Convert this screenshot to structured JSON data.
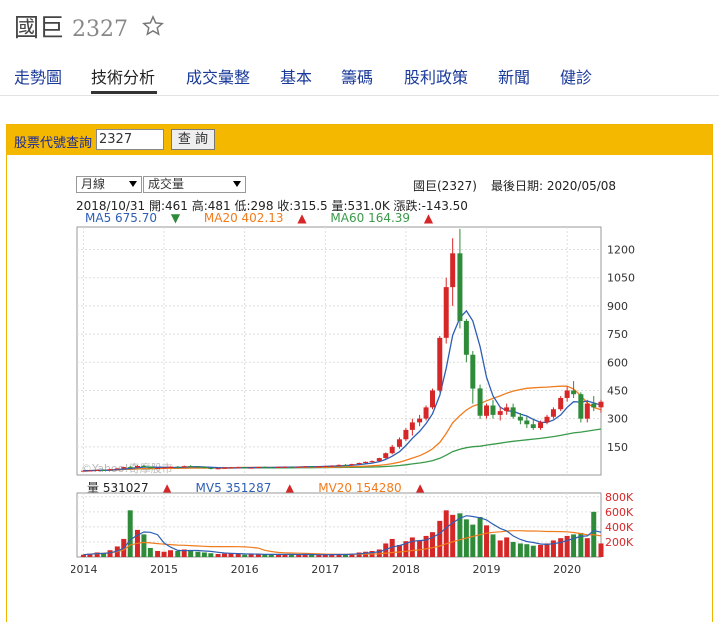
{
  "header": {
    "name": "國巨",
    "code": "2327"
  },
  "tabs": [
    {
      "label": "走勢圖",
      "active": false
    },
    {
      "label": "技術分析",
      "active": true
    },
    {
      "label": "成交彙整",
      "active": false
    },
    {
      "label": "基本",
      "active": false
    },
    {
      "label": "籌碼",
      "active": false
    },
    {
      "label": "股利政策",
      "active": false
    },
    {
      "label": "新聞",
      "active": false
    },
    {
      "label": "健診",
      "active": false
    }
  ],
  "query": {
    "label": "股票代號查詢",
    "value": "2327",
    "button": "查 詢"
  },
  "controls": {
    "period": "月線",
    "indicator": "成交量"
  },
  "chart_header": {
    "stock": "國巨(2327)",
    "last_date": "最後日期: 2020/05/08",
    "ohlc": "2018/10/31 開:461 高:481 低:298 收:315.5 量:531.0K 漲跌:-143.50",
    "ma5": "MA5 675.70",
    "ma20": "MA20 402.13",
    "ma60": "MA60 164.39",
    "ma5_dir": "down",
    "ma20_dir": "up",
    "ma60_dir": "up",
    "vol": "量 531027",
    "mv5": "MV5 351287",
    "mv20": "MV20 154280",
    "watermark": "©Yahoo!奇摩股市"
  },
  "colors": {
    "up": "#d62728",
    "down": "#2e8b3a",
    "ma5": "#2e5fb5",
    "ma20": "#f07c1e",
    "ma60": "#3a9a4a",
    "accent": "#f5b800",
    "link": "#1a3a9a"
  },
  "chart_data": {
    "type": "candlestick",
    "price_axis": {
      "ticks": [
        150,
        300,
        450,
        600,
        750,
        900,
        1050,
        1200
      ],
      "ylim": [
        0,
        1320
      ]
    },
    "volume_axis": {
      "ticks": [
        "200K",
        "400K",
        "600K",
        "800K"
      ],
      "ylim": [
        0,
        850000
      ]
    },
    "x_ticks": [
      "2014",
      "2015",
      "2016",
      "2017",
      "2018",
      "2019",
      "2020"
    ],
    "x_start": 2013.92,
    "x_end": 2020.42,
    "candles": [
      [
        2014.0,
        22,
        24,
        21,
        23
      ],
      [
        2014.08,
        23,
        25,
        22,
        24
      ],
      [
        2014.17,
        24,
        28,
        23,
        27
      ],
      [
        2014.25,
        27,
        30,
        25,
        26
      ],
      [
        2014.33,
        26,
        32,
        25,
        31
      ],
      [
        2014.42,
        31,
        36,
        30,
        35
      ],
      [
        2014.5,
        35,
        44,
        33,
        42
      ],
      [
        2014.58,
        42,
        50,
        38,
        40
      ],
      [
        2014.67,
        40,
        52,
        38,
        48
      ],
      [
        2014.75,
        48,
        55,
        40,
        44
      ],
      [
        2014.83,
        44,
        46,
        34,
        36
      ],
      [
        2014.92,
        36,
        40,
        32,
        38
      ],
      [
        2015.0,
        38,
        42,
        35,
        40
      ],
      [
        2015.08,
        40,
        46,
        38,
        44
      ],
      [
        2015.17,
        44,
        48,
        40,
        42
      ],
      [
        2015.25,
        42,
        50,
        40,
        47
      ],
      [
        2015.33,
        47,
        52,
        42,
        44
      ],
      [
        2015.42,
        44,
        48,
        40,
        43
      ],
      [
        2015.5,
        43,
        45,
        36,
        38
      ],
      [
        2015.58,
        38,
        40,
        30,
        34
      ],
      [
        2015.67,
        34,
        38,
        31,
        36
      ],
      [
        2015.75,
        36,
        40,
        34,
        38
      ],
      [
        2015.83,
        38,
        42,
        36,
        40
      ],
      [
        2015.92,
        40,
        44,
        38,
        41
      ],
      [
        2016.0,
        41,
        43,
        36,
        38
      ],
      [
        2016.08,
        38,
        40,
        35,
        39
      ],
      [
        2016.17,
        39,
        44,
        38,
        42
      ],
      [
        2016.25,
        42,
        45,
        40,
        41
      ],
      [
        2016.33,
        41,
        43,
        38,
        40
      ],
      [
        2016.42,
        40,
        44,
        38,
        43
      ],
      [
        2016.5,
        43,
        46,
        41,
        44
      ],
      [
        2016.58,
        44,
        46,
        40,
        42
      ],
      [
        2016.67,
        42,
        45,
        40,
        44
      ],
      [
        2016.75,
        44,
        48,
        42,
        46
      ],
      [
        2016.83,
        46,
        48,
        42,
        44
      ],
      [
        2016.92,
        44,
        47,
        43,
        46
      ],
      [
        2017.0,
        46,
        50,
        44,
        48
      ],
      [
        2017.08,
        48,
        52,
        46,
        50
      ],
      [
        2017.17,
        50,
        56,
        48,
        54
      ],
      [
        2017.25,
        54,
        58,
        50,
        52
      ],
      [
        2017.33,
        52,
        60,
        50,
        58
      ],
      [
        2017.42,
        58,
        66,
        56,
        64
      ],
      [
        2017.5,
        64,
        72,
        60,
        70
      ],
      [
        2017.58,
        70,
        78,
        66,
        74
      ],
      [
        2017.67,
        74,
        92,
        72,
        90
      ],
      [
        2017.75,
        90,
        120,
        86,
        116
      ],
      [
        2017.83,
        116,
        160,
        110,
        150
      ],
      [
        2017.92,
        150,
        200,
        140,
        190
      ],
      [
        2018.0,
        190,
        250,
        180,
        240
      ],
      [
        2018.08,
        240,
        300,
        210,
        280
      ],
      [
        2018.17,
        280,
        320,
        260,
        300
      ],
      [
        2018.25,
        300,
        370,
        290,
        360
      ],
      [
        2018.33,
        360,
        460,
        350,
        450
      ],
      [
        2018.42,
        450,
        740,
        440,
        730
      ],
      [
        2018.5,
        730,
        1050,
        700,
        1000
      ],
      [
        2018.58,
        1000,
        1260,
        900,
        1180
      ],
      [
        2018.67,
        1180,
        1310,
        780,
        820
      ],
      [
        2018.75,
        820,
        830,
        600,
        640
      ],
      [
        2018.83,
        640,
        660,
        380,
        460
      ],
      [
        2018.92,
        461,
        481,
        298,
        315.5
      ],
      [
        2019.0,
        315,
        380,
        300,
        370
      ],
      [
        2019.08,
        370,
        400,
        300,
        320
      ],
      [
        2019.17,
        320,
        360,
        290,
        340
      ],
      [
        2019.25,
        340,
        380,
        320,
        360
      ],
      [
        2019.33,
        360,
        380,
        300,
        310
      ],
      [
        2019.42,
        310,
        330,
        270,
        290
      ],
      [
        2019.5,
        290,
        310,
        250,
        270
      ],
      [
        2019.58,
        270,
        300,
        240,
        250
      ],
      [
        2019.67,
        250,
        290,
        240,
        280
      ],
      [
        2019.75,
        280,
        320,
        270,
        310
      ],
      [
        2019.83,
        310,
        360,
        300,
        350
      ],
      [
        2019.92,
        350,
        420,
        340,
        410
      ],
      [
        2020.0,
        410,
        470,
        390,
        450
      ],
      [
        2020.08,
        450,
        500,
        410,
        430
      ],
      [
        2020.17,
        430,
        440,
        280,
        300
      ],
      [
        2020.25,
        300,
        400,
        280,
        380
      ],
      [
        2020.33,
        380,
        420,
        340,
        360
      ],
      [
        2020.42,
        360,
        400,
        330,
        390
      ]
    ],
    "volumes": [
      [
        2014.0,
        30000
      ],
      [
        2014.08,
        45000
      ],
      [
        2014.17,
        60000
      ],
      [
        2014.25,
        55000
      ],
      [
        2014.33,
        90000
      ],
      [
        2014.42,
        140000
      ],
      [
        2014.5,
        240000
      ],
      [
        2014.58,
        620000
      ],
      [
        2014.67,
        360000
      ],
      [
        2014.75,
        300000
      ],
      [
        2014.83,
        120000
      ],
      [
        2014.92,
        80000
      ],
      [
        2015.0,
        70000
      ],
      [
        2015.08,
        90000
      ],
      [
        2015.17,
        80000
      ],
      [
        2015.25,
        100000
      ],
      [
        2015.33,
        90000
      ],
      [
        2015.42,
        70000
      ],
      [
        2015.5,
        60000
      ],
      [
        2015.58,
        50000
      ],
      [
        2015.67,
        40000
      ],
      [
        2015.75,
        45000
      ],
      [
        2015.83,
        50000
      ],
      [
        2015.92,
        40000
      ],
      [
        2016.0,
        30000
      ],
      [
        2016.08,
        35000
      ],
      [
        2016.17,
        40000
      ],
      [
        2016.25,
        35000
      ],
      [
        2016.33,
        30000
      ],
      [
        2016.42,
        35000
      ],
      [
        2016.5,
        40000
      ],
      [
        2016.58,
        30000
      ],
      [
        2016.67,
        30000
      ],
      [
        2016.75,
        35000
      ],
      [
        2016.83,
        30000
      ],
      [
        2016.92,
        28000
      ],
      [
        2017.0,
        30000
      ],
      [
        2017.08,
        35000
      ],
      [
        2017.17,
        40000
      ],
      [
        2017.25,
        35000
      ],
      [
        2017.33,
        45000
      ],
      [
        2017.42,
        60000
      ],
      [
        2017.5,
        70000
      ],
      [
        2017.58,
        80000
      ],
      [
        2017.67,
        100000
      ],
      [
        2017.75,
        180000
      ],
      [
        2017.83,
        240000
      ],
      [
        2017.92,
        160000
      ],
      [
        2018.0,
        210000
      ],
      [
        2018.08,
        260000
      ],
      [
        2018.17,
        220000
      ],
      [
        2018.25,
        280000
      ],
      [
        2018.33,
        330000
      ],
      [
        2018.42,
        480000
      ],
      [
        2018.5,
        620000
      ],
      [
        2018.58,
        560000
      ],
      [
        2018.67,
        580000
      ],
      [
        2018.75,
        500000
      ],
      [
        2018.83,
        430000
      ],
      [
        2018.92,
        531027
      ],
      [
        2019.0,
        420000
      ],
      [
        2019.08,
        300000
      ],
      [
        2019.17,
        220000
      ],
      [
        2019.25,
        260000
      ],
      [
        2019.33,
        200000
      ],
      [
        2019.42,
        180000
      ],
      [
        2019.5,
        170000
      ],
      [
        2019.58,
        150000
      ],
      [
        2019.67,
        160000
      ],
      [
        2019.75,
        180000
      ],
      [
        2019.83,
        220000
      ],
      [
        2019.92,
        250000
      ],
      [
        2020.0,
        280000
      ],
      [
        2020.08,
        300000
      ],
      [
        2020.17,
        320000
      ],
      [
        2020.25,
        250000
      ],
      [
        2020.33,
        600000
      ],
      [
        2020.42,
        180000
      ]
    ]
  }
}
